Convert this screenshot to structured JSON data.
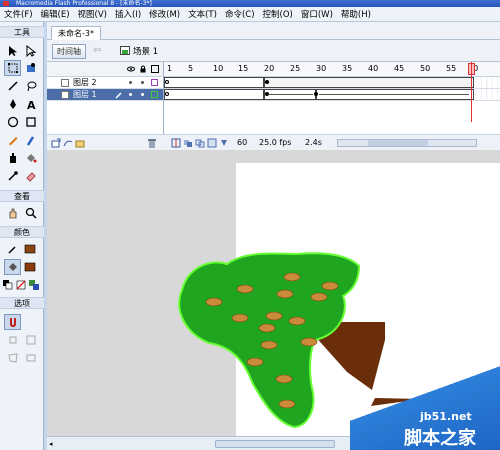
{
  "titlebar": {
    "title": "Macromedia Flash Professional 8 - [未命名-3*]"
  },
  "menu": [
    "文件(F)",
    "编辑(E)",
    "视图(V)",
    "插入(I)",
    "修改(M)",
    "文本(T)",
    "命令(C)",
    "控制(O)",
    "窗口(W)",
    "帮助(H)"
  ],
  "tools": {
    "title": "工具",
    "view_title": "查看",
    "colors_title": "颜色",
    "options_title": "选项"
  },
  "document": {
    "tab": "未命名-3*",
    "timeline_button": "时间轴",
    "scene_label": "场景 1"
  },
  "timeline": {
    "ruler": [
      "1",
      "5",
      "10",
      "15",
      "20",
      "25",
      "30",
      "35",
      "40",
      "45",
      "50",
      "55",
      "60"
    ],
    "layers": [
      {
        "name": "图层 2",
        "color": "#9b3fc4"
      },
      {
        "name": "图层 1",
        "color": "#3fce3f"
      }
    ],
    "current_frame": "60",
    "fps": "25.0 fps",
    "time": "2.4s"
  },
  "watermark": {
    "url": "jb51.net",
    "text": "脚本之家"
  },
  "colors": {
    "stroke": "#8b4513",
    "fill": "#8b3a0e",
    "tree_green": "#1fa51f",
    "tree_stroke": "#66ff33",
    "spot": "#c98a3a",
    "trunk": "#6b2e0a"
  }
}
